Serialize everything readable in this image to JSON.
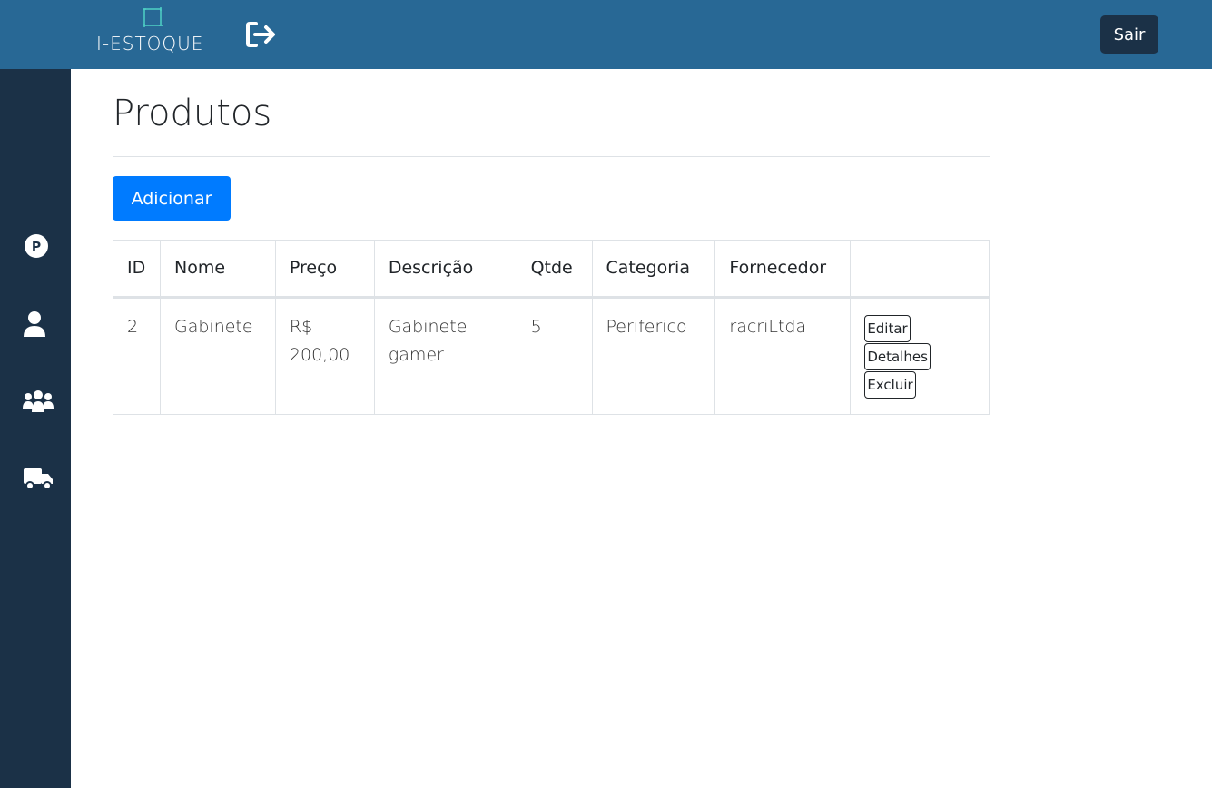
{
  "header": {
    "logo_text": "I-ESTOQUE",
    "logout_button": "Sair",
    "brand_color": "#286895",
    "dark_color": "#1b3147"
  },
  "sidebar": {
    "items": [
      {
        "icon": "parking-circle-icon"
      },
      {
        "icon": "user-icon"
      },
      {
        "icon": "users-group-icon"
      },
      {
        "icon": "truck-icon"
      }
    ]
  },
  "main": {
    "title": "Produtos",
    "add_button": "Adicionar",
    "table": {
      "headers": [
        "ID",
        "Nome",
        "Preço",
        "Descrição",
        "Qtde",
        "Categoria",
        "Fornecedor",
        ""
      ],
      "rows": [
        {
          "id": "2",
          "nome": "Gabinete",
          "preco": "R$ 200,00",
          "descricao": "Gabinete gamer",
          "qtde": "5",
          "categoria": "Periferico",
          "fornecedor": "racriLtda",
          "actions": [
            "Editar",
            "Detalhes",
            "Excluir"
          ]
        }
      ]
    }
  }
}
